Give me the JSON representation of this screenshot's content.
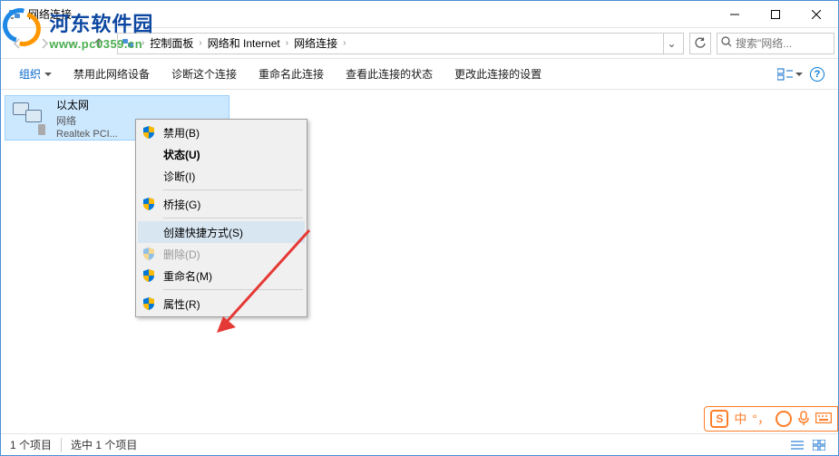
{
  "watermark": {
    "title": "河东软件园",
    "url": "www.pc0359.cn"
  },
  "titlebar": {
    "title": "网络连接"
  },
  "breadcrumb": {
    "items": [
      "控制面板",
      "网络和 Internet",
      "网络连接"
    ]
  },
  "search": {
    "placeholder": "搜索\"网络..."
  },
  "cmdbar": {
    "organize": "组织",
    "items": [
      "禁用此网络设备",
      "诊断这个连接",
      "重命名此连接",
      "查看此连接的状态",
      "更改此连接的设置"
    ]
  },
  "adapter": {
    "name": "以太网",
    "network": "网络",
    "device": "Realtek PCI..."
  },
  "ctxmenu": {
    "disable": "禁用(B)",
    "status": "状态(U)",
    "diagnose": "诊断(I)",
    "bridge": "桥接(G)",
    "shortcut": "创建快捷方式(S)",
    "delete": "删除(D)",
    "rename": "重命名(M)",
    "properties": "属性(R)"
  },
  "statusbar": {
    "count": "1 个项目",
    "selected": "选中 1 个项目"
  },
  "ime": {
    "logo": "S",
    "lang": "中"
  }
}
